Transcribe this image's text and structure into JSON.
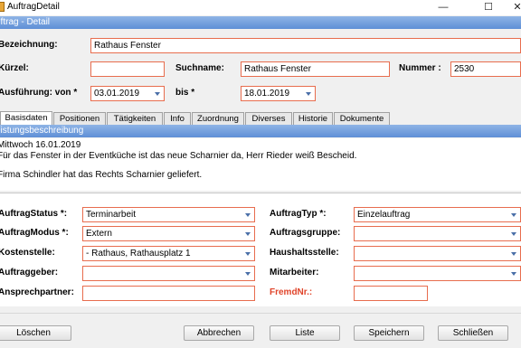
{
  "window": {
    "title": "AuftragDetail",
    "minimize": "—",
    "maximize": "☐",
    "close": "✕"
  },
  "section_title": "uftrag - Detail",
  "header": {
    "bezeichnung_label": "Bezeichnung:",
    "bezeichnung_value": "Rathaus Fenster",
    "kuerzel_label": "Kürzel:",
    "kuerzel_value": "",
    "suchname_label": "Suchname:",
    "suchname_value": "Rathaus Fenster",
    "nummer_label": "Nummer :",
    "nummer_value": "2530",
    "ausfuehrung_label": "Ausführung: von *",
    "von_value": "03.01.2019",
    "bis_label": "bis *",
    "bis_value": "18.01.2019"
  },
  "tabs": [
    "Basisdaten",
    "Positionen",
    "Tätigkeiten",
    "Info",
    "Zuordnung",
    "Diverses",
    "Historie",
    "Dokumente"
  ],
  "description": {
    "title": "eistungsbeschreibung",
    "lines": [
      "Mittwoch 16.01.2019",
      "Für das Fenster in der Eventküche ist das neue Scharnier da, Herr Rieder weiß Bescheid.",
      "",
      "Firma Schindler hat das Rechts Scharnier geliefert."
    ]
  },
  "form": {
    "status_label": "AuftragStatus *:",
    "status_value": "Terminarbeit",
    "typ_label": "AuftragTyp *:",
    "typ_value": "Einzelauftrag",
    "modus_label": "AuftragModus *:",
    "modus_value": "Extern",
    "gruppe_label": "Auftragsgruppe:",
    "gruppe_value": "",
    "kostenstelle_label": "Kostenstelle:",
    "kostenstelle_value": "- Rathaus, Rathausplatz 1",
    "haushalt_label": "Haushaltsstelle:",
    "haushalt_value": "",
    "auftraggeber_label": "Auftraggeber:",
    "auftraggeber_value": "",
    "mitarbeiter_label": "Mitarbeiter:",
    "mitarbeiter_value": "",
    "ansprech_label": "Ansprechpartner:",
    "ansprech_value": "",
    "fremd_label": "FremdNr.:",
    "fremd_value": ""
  },
  "buttons": {
    "loeschen": "Löschen",
    "abbrechen": "Abbrechen",
    "liste": "Liste",
    "speichern": "Speichern",
    "schliessen": "Schließen"
  },
  "colors": {
    "field_border": "#e86d4e",
    "section_bar": "#5e8fd6",
    "fremd_label": "#e0442a"
  }
}
